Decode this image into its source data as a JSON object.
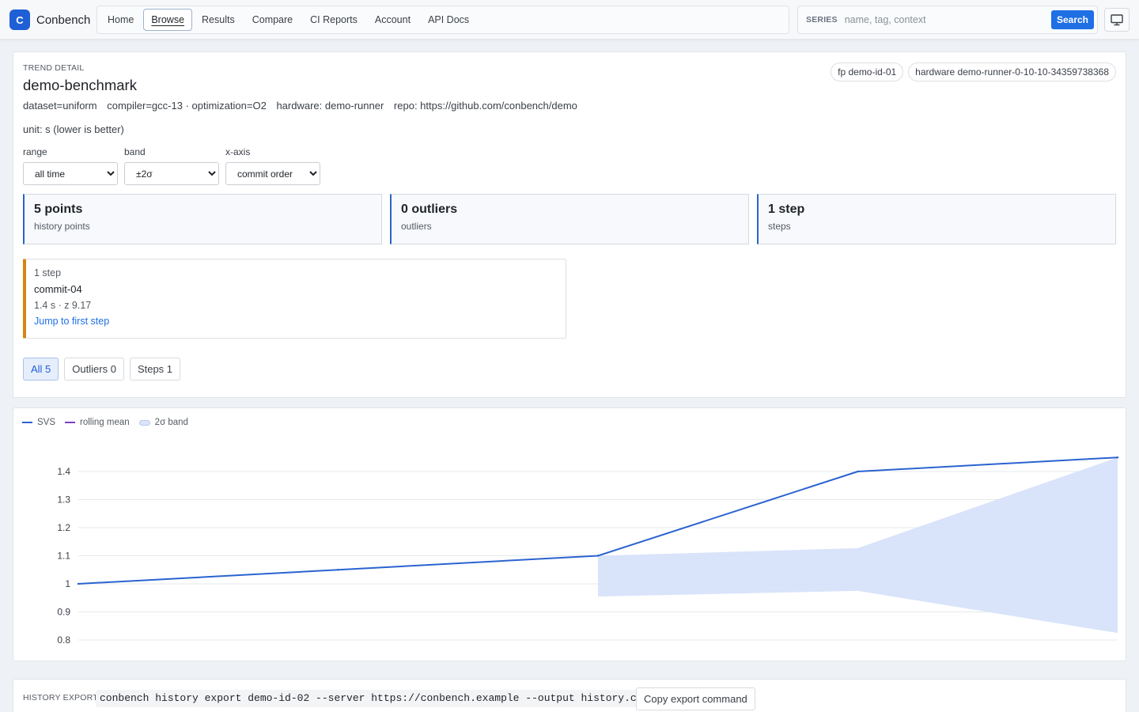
{
  "brand": {
    "logo_letter": "C",
    "name": "Conbench"
  },
  "nav": {
    "items": [
      {
        "label": "Home",
        "active": false
      },
      {
        "label": "Browse",
        "active": true
      },
      {
        "label": "Results",
        "active": false
      },
      {
        "label": "Compare",
        "active": false
      },
      {
        "label": "CI Reports",
        "active": false
      },
      {
        "label": "Account",
        "active": false
      },
      {
        "label": "API Docs",
        "active": false
      }
    ]
  },
  "search": {
    "label": "SERIES",
    "placeholder": "name, tag, context",
    "button": "Search"
  },
  "display_icon": "monitor-icon",
  "trend": {
    "eyebrow": "TREND DETAIL",
    "title": "demo-benchmark",
    "pills": [
      "fp demo-id-01",
      "hardware demo-runner-0-10-10-34359738368"
    ],
    "meta": [
      "dataset=uniform",
      "compiler=gcc-13 · optimization=O2",
      "hardware: demo-runner",
      "repo: https://github.com/conbench/demo"
    ],
    "unit": "unit: s (lower is better)",
    "controls": [
      {
        "label": "range",
        "value": "all time"
      },
      {
        "label": "band",
        "value": "±2σ"
      },
      {
        "label": "x-axis",
        "value": "commit order"
      }
    ],
    "stats": [
      {
        "value": "5 points",
        "label": "history points"
      },
      {
        "value": "0 outliers",
        "label": "outliers"
      },
      {
        "value": "1 step",
        "label": "steps"
      }
    ],
    "step": {
      "heading": "1 step",
      "commit": "commit-04",
      "detail": "1.4 s · z 9.17",
      "link": "Jump to first step"
    },
    "filters": [
      {
        "label": "All 5",
        "active": true
      },
      {
        "label": "Outliers 0",
        "active": false
      },
      {
        "label": "Steps 1",
        "active": false
      }
    ]
  },
  "legend": [
    {
      "label": "SVS",
      "color": "#2b63d0",
      "kind": "line"
    },
    {
      "label": "rolling mean",
      "color": "#7b3fc4",
      "kind": "line"
    },
    {
      "label": "2σ band",
      "color": "#dbe5fb",
      "kind": "band"
    }
  ],
  "chart_data": {
    "type": "line",
    "x": [
      1,
      2,
      3,
      4,
      5
    ],
    "series": [
      {
        "name": "SVS",
        "values": [
          1.0,
          1.05,
          1.1,
          1.4,
          1.45
        ],
        "color": "#2b63d0"
      }
    ],
    "band": {
      "name": "2σ band",
      "x": [
        3,
        4,
        5
      ],
      "upper": [
        1.1,
        1.127,
        1.45
      ],
      "lower": [
        0.955,
        0.975,
        0.825
      ],
      "color": "#d7e1fa"
    },
    "yticks": [
      0.8,
      0.9,
      1,
      1.1,
      1.2,
      1.3,
      1.4
    ],
    "ylim": [
      0.8,
      1.45
    ],
    "grid": true,
    "legend_position": "top-left"
  },
  "export": {
    "label": "HISTORY EXPORT",
    "command": "conbench history export demo-id-02 --server https://conbench.example --output history.csv",
    "copy_label": "Copy export command"
  }
}
